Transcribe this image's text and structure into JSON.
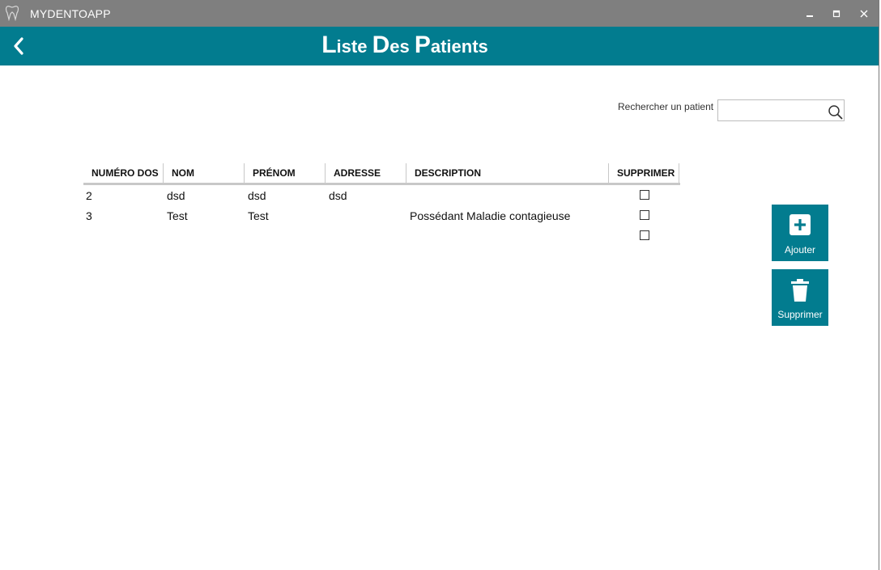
{
  "window": {
    "title": "MYDENTOAPP"
  },
  "header": {
    "title_parts": [
      "L",
      "iste ",
      "D",
      "es ",
      "P",
      "atients"
    ]
  },
  "search": {
    "label": "Rechercher un patient",
    "value": "",
    "placeholder": ""
  },
  "table": {
    "columns": [
      "NUMÉRO DOS",
      "NOM",
      "PRÉNOM",
      "ADRESSE",
      "DESCRIPTION",
      "SUPPRIMER"
    ],
    "rows": [
      {
        "num": "2",
        "nom": "dsd",
        "prenom": "dsd",
        "adresse": "dsd",
        "description": "",
        "supprimer": false
      },
      {
        "num": "3",
        "nom": "Test",
        "prenom": "Test",
        "adresse": "",
        "description": "Possédant Maladie contagieuse",
        "supprimer": false
      },
      {
        "num": "",
        "nom": "",
        "prenom": "",
        "adresse": "",
        "description": "",
        "supprimer": false
      }
    ]
  },
  "actions": {
    "add_label": "Ajouter",
    "delete_label": "Supprimer"
  },
  "colors": {
    "titlebar": "#7f7f7f",
    "accent": "#027c8f"
  }
}
